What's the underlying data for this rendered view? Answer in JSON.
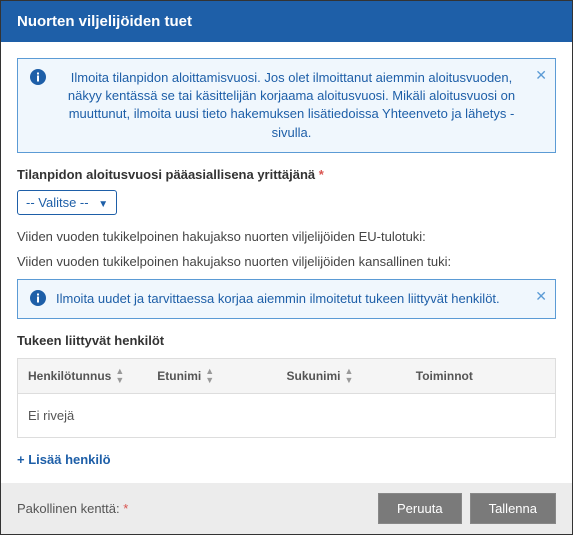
{
  "header": {
    "title": "Nuorten viljelijöiden tuet"
  },
  "info1": {
    "text": "Ilmoita tilanpidon aloittamisvuosi. Jos olet ilmoittanut aiemmin aloitusvuoden, näkyy kentässä se tai käsittelijän korjaama aloitusvuosi. Mikäli aloitusvuosi on muuttunut, ilmoita uusi tieto hakemuksen lisätiedoissa Yhteenveto ja lähetys -sivulla."
  },
  "form": {
    "year_label": "Tilanpidon aloitusvuosi pääasiallisena yrittäjänä",
    "select_placeholder": "-- Valitse --",
    "line1": "Viiden vuoden tukikelpoinen hakujakso nuorten viljelijöiden EU-tulotuki:",
    "line2": "Viiden vuoden tukikelpoinen hakujakso nuorten viljelijöiden kansallinen tuki:"
  },
  "info2": {
    "text": "Ilmoita uudet ja tarvittaessa korjaa aiemmin ilmoitetut tukeen liittyvät henkilöt."
  },
  "persons": {
    "title": "Tukeen liittyvät henkilöt",
    "columns": {
      "c1": "Henkilötunnus",
      "c2": "Etunimi",
      "c3": "Sukunimi",
      "c4": "Toiminnot"
    },
    "empty": "Ei rivejä",
    "add": "Lisää henkilö"
  },
  "footer": {
    "required_label": "Pakollinen kenttä:",
    "cancel": "Peruuta",
    "save": "Tallenna"
  }
}
